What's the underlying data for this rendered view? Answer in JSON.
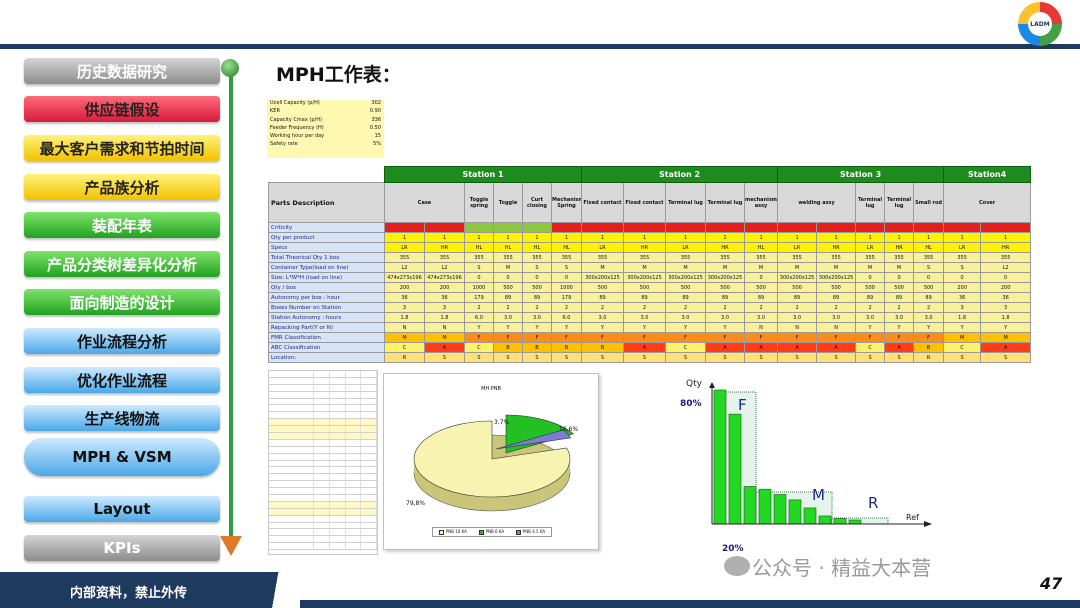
{
  "header": {
    "logo_text": "LADM"
  },
  "nav": {
    "items": [
      {
        "label": "历史数据研究",
        "style": "g-gray"
      },
      {
        "label": "供应链假设",
        "style": "g-red"
      },
      {
        "label": "最大客户需求和节拍时间",
        "style": "g-yel"
      },
      {
        "label": "产品族分析",
        "style": "g-yel"
      },
      {
        "label": "装配年表",
        "style": "g-grn"
      },
      {
        "label": "产品分类树差异化分析",
        "style": "g-grn"
      },
      {
        "label": "面向制造的设计",
        "style": "g-grn"
      },
      {
        "label": "作业流程分析",
        "style": "g-blu"
      },
      {
        "label": "优化作业流程",
        "style": "g-blu"
      },
      {
        "label": "生产线物流",
        "style": "g-blu"
      },
      {
        "label": "MPH & VSM",
        "style": "g-blu",
        "current": true
      },
      {
        "label": "Layout",
        "style": "g-blu"
      },
      {
        "label": "KPIs",
        "style": "g-gray"
      }
    ]
  },
  "title": "MPH工作表：",
  "params": [
    {
      "label": "Ucell Capacity (p/H)",
      "value": "302"
    },
    {
      "label": "KER",
      "value": "0.90"
    },
    {
      "label": "Capacity Cmax (p/H)",
      "value": "336"
    },
    {
      "label": "Feeder Frequency (H)",
      "value": "0.50"
    },
    {
      "label": "Working hour per day",
      "value": "15"
    },
    {
      "label": "Safety rate",
      "value": "5%"
    }
  ],
  "stations": [
    "Station 1",
    "Station 2",
    "Station 3",
    "Station4"
  ],
  "parts_header": "Parts Description",
  "columns": [
    "Case",
    "",
    "Toggle spring",
    "Toggle",
    "Curt closing",
    "Mechanism Spring",
    "Fixed contact",
    "Fixed contact",
    "Terminal lug",
    "Terminal lug",
    "mechanism assy",
    "welding assy",
    "",
    "Terminal lug",
    "Terminal lug",
    "Small rod",
    "Cover",
    ""
  ],
  "rows": [
    {
      "label": "Criticity",
      "cls": "r-crit",
      "values": [
        "",
        "",
        "",
        "",
        "",
        "",
        "",
        "",
        "",
        "",
        "",
        "",
        "",
        "",
        "",
        "",
        "",
        ""
      ]
    },
    {
      "label": "Qty per product",
      "cls": "r-qty",
      "values": [
        "1",
        "1",
        "1",
        "1",
        "1",
        "1",
        "1",
        "1",
        "1",
        "1",
        "1",
        "1",
        "1",
        "1",
        "1",
        "1",
        "1",
        "1"
      ]
    },
    {
      "label": "Specs",
      "cls": "r-spec",
      "values": [
        "LR",
        "HR",
        "HL",
        "HL",
        "HL",
        "HL",
        "LR",
        "HR",
        "LR",
        "HR",
        "HL",
        "LR",
        "HR",
        "LR",
        "HR",
        "HL",
        "LR",
        "HR"
      ]
    },
    {
      "label": "Total Theorical Qty 1 box",
      "cls": "",
      "values": [
        "355",
        "355",
        "355",
        "355",
        "355",
        "355",
        "355",
        "355",
        "355",
        "355",
        "355",
        "355",
        "355",
        "355",
        "355",
        "355",
        "355",
        "355"
      ]
    },
    {
      "label": "Container Type(load on line)",
      "cls": "",
      "values": [
        "L2",
        "L2",
        "S",
        "M",
        "S",
        "S",
        "M",
        "M",
        "M",
        "M",
        "M",
        "M",
        "M",
        "M",
        "M",
        "S",
        "S",
        "L2"
      ]
    },
    {
      "label": "Size: L*W*H (load on line)",
      "cls": "",
      "values": [
        "474x273x196",
        "474x273x196",
        "0",
        "0",
        "0",
        "0",
        "300x200x125",
        "300x200x125",
        "300x200x125",
        "300x200x125",
        "0",
        "300x200x125",
        "300x200x125",
        "0",
        "0",
        "0",
        "0",
        "0"
      ]
    },
    {
      "label": "Qty / box",
      "cls": "",
      "values": [
        "200",
        "200",
        "1000",
        "500",
        "500",
        "1000",
        "500",
        "500",
        "500",
        "500",
        "500",
        "500",
        "500",
        "500",
        "500",
        "500",
        "200",
        "200"
      ]
    },
    {
      "label": "Autonomy per box : hour",
      "cls": "",
      "values": [
        "36",
        "36",
        "179",
        "89",
        "89",
        "179",
        "89",
        "89",
        "89",
        "89",
        "89",
        "89",
        "89",
        "89",
        "89",
        "89",
        "36",
        "36"
      ]
    },
    {
      "label": "Boxes Number on Station",
      "cls": "",
      "values": [
        "3",
        "3",
        "2",
        "2",
        "2",
        "2",
        "2",
        "2",
        "2",
        "2",
        "2",
        "2",
        "2",
        "2",
        "2",
        "2",
        "3",
        "3"
      ]
    },
    {
      "label": "Station Autonomy : hours",
      "cls": "",
      "values": [
        "1.8",
        "1.8",
        "6.0",
        "3.0",
        "3.0",
        "6.0",
        "3.0",
        "3.0",
        "3.0",
        "3.0",
        "3.0",
        "3.0",
        "3.0",
        "3.0",
        "3.0",
        "3.0",
        "1.8",
        "1.8"
      ]
    },
    {
      "label": "Repacking Part(Y or N)",
      "cls": "",
      "values": [
        "N",
        "N",
        "Y",
        "Y",
        "Y",
        "Y",
        "Y",
        "Y",
        "Y",
        "Y",
        "N",
        "N",
        "N",
        "Y",
        "Y",
        "Y",
        "Y",
        "Y"
      ]
    },
    {
      "label": "FMR Classification",
      "cls": "r-fmr",
      "values": [
        "M",
        "M",
        "F",
        "F",
        "F",
        "F",
        "F",
        "F",
        "F",
        "F",
        "F",
        "F",
        "F",
        "F",
        "F",
        "F",
        "M",
        "M"
      ]
    },
    {
      "label": "ABC Classification",
      "cls": "r-abc",
      "values": [
        "C",
        "A",
        "C",
        "B",
        "B",
        "B",
        "B",
        "A",
        "C",
        "A",
        "A",
        "A",
        "A",
        "C",
        "A",
        "B",
        "C",
        "A"
      ]
    },
    {
      "label": "Location:",
      "cls": "r-loc",
      "values": [
        "R",
        "S",
        "S",
        "S",
        "S",
        "S",
        "S",
        "S",
        "S",
        "S",
        "S",
        "S",
        "S",
        "S",
        "S",
        "R",
        "S",
        "S"
      ]
    }
  ],
  "pie": {
    "title": "MH PNB",
    "legend": [
      "PNB 10 KA",
      "PNB 6 KA",
      "PNB 4.5 KA"
    ]
  },
  "chart_data": {
    "type": "pie",
    "title": "MH PNB",
    "labels": [
      "PNB 10 KA",
      "PNB 6 KA",
      "PNB 4.5 KA"
    ],
    "values": [
      79.8,
      16.6,
      3.7
    ],
    "value_labels": [
      "79,8%",
      "16,6%",
      "3,7%"
    ],
    "colors": [
      "#f7f3b0",
      "#22c022",
      "#7c7cd6"
    ]
  },
  "pareto": {
    "y_label": "Qty",
    "x_label": "Ref",
    "pct_80": "80%",
    "pct_20": "20%",
    "zones": [
      "F",
      "M",
      "R"
    ],
    "bars": [
      100,
      82,
      28,
      26,
      22,
      18,
      12,
      6,
      4,
      3
    ]
  },
  "footer": {
    "text": "内部资料，禁止外传",
    "watermark": "公众号 · 精益大本营",
    "page": "47"
  }
}
